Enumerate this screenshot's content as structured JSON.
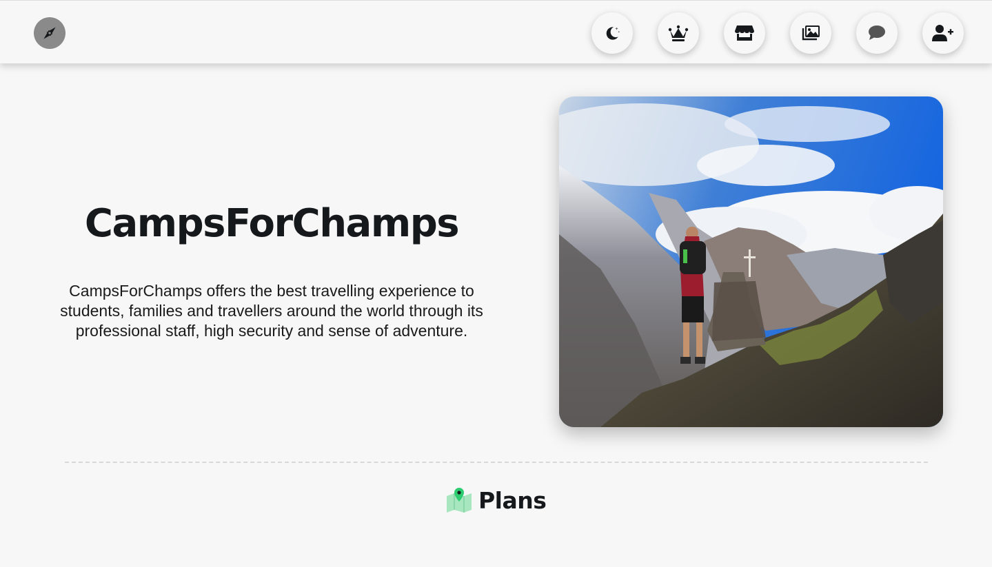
{
  "navbar": {
    "brand_icon": "compass-icon",
    "buttons": [
      {
        "icon": "moon-stars-icon"
      },
      {
        "icon": "crown-icon"
      },
      {
        "icon": "store-icon"
      },
      {
        "icon": "images-icon"
      },
      {
        "icon": "comment-icon"
      },
      {
        "icon": "user-plus-icon"
      }
    ]
  },
  "hero": {
    "title": "CampsForChamps",
    "description": "CampsForChamps offers the best travelling experience to students, families and travellers around the world through its professional staff, high security and sense of adventure.",
    "image": "hiker-on-mountain-photo"
  },
  "plans": {
    "icon": "map-pin-icon",
    "title": "Plans"
  },
  "colors": {
    "background": "#f7f7f7",
    "text": "#16191c",
    "accent_green": "#2ecc71",
    "brand_gray": "#8a8a8a"
  }
}
